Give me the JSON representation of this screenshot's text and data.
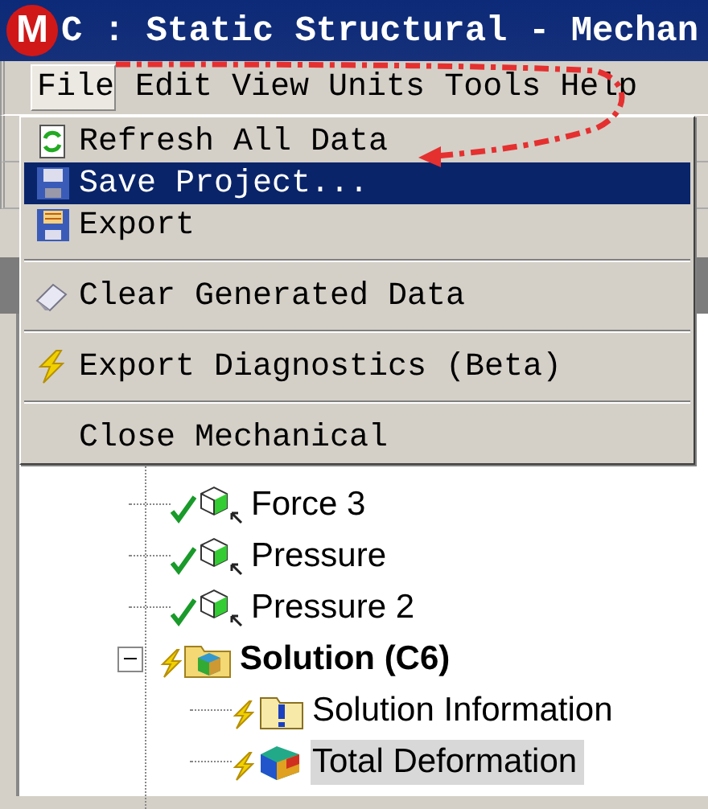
{
  "window": {
    "logo": "M",
    "title": "C : Static Structural - Mechan"
  },
  "menubar": [
    {
      "label": "File",
      "selected": true
    },
    {
      "label": "Edit",
      "selected": false
    },
    {
      "label": "View",
      "selected": false
    },
    {
      "label": "Units",
      "selected": false
    },
    {
      "label": "Tools",
      "selected": false
    },
    {
      "label": "Help",
      "selected": false
    }
  ],
  "menu": [
    {
      "kind": "refresh",
      "label": "Refresh All Data",
      "selected": false
    },
    {
      "kind": "save",
      "label": "Save Project...",
      "selected": true
    },
    {
      "kind": "export",
      "label": "Export",
      "selected": false
    },
    {
      "kind": "separator"
    },
    {
      "kind": "clear",
      "label": "Clear Generated Data",
      "selected": false
    },
    {
      "kind": "separator"
    },
    {
      "kind": "diagnostics",
      "label": "Export Diagnostics (Beta)",
      "selected": false
    },
    {
      "kind": "separator"
    },
    {
      "kind": "plain",
      "label": "Close Mechanical",
      "selected": false
    }
  ],
  "tree": [
    {
      "kind": "load",
      "label": "Force 3",
      "solved": true,
      "selected": false
    },
    {
      "kind": "load",
      "label": "Pressure",
      "solved": true,
      "selected": false
    },
    {
      "kind": "load",
      "label": "Pressure 2",
      "solved": true,
      "selected": false
    },
    {
      "kind": "solution",
      "label": "Solution (C6)",
      "solved": false,
      "selected": false,
      "expanded": true,
      "children": [
        {
          "kind": "information",
          "label": "Solution Information",
          "solved": false,
          "selected": false
        },
        {
          "kind": "result",
          "label": "Total Deformation",
          "solved": false,
          "selected": true
        }
      ]
    }
  ]
}
